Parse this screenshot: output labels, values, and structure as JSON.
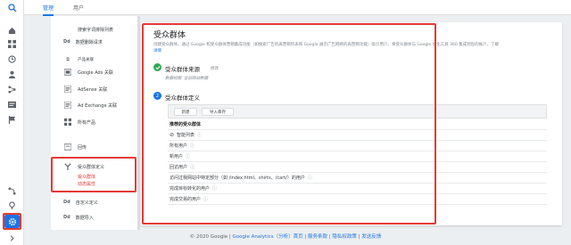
{
  "tabs": [
    {
      "label": "管理",
      "active": true
    },
    {
      "label": "用户",
      "active": false
    }
  ],
  "rail_icons": [
    "search-icon",
    "home-icon",
    "dashboard-icon",
    "clock-icon",
    "person-icon",
    "acquisition-icon",
    "behavior-icon",
    "flag-icon"
  ],
  "nav": {
    "items": [
      {
        "label": "搜索字词排除列表",
        "icon": ""
      },
      {
        "label": "数据删除请求",
        "icon": "Dd"
      },
      {
        "label": "产品关联",
        "icon": ""
      },
      {
        "label": "Google Ads 关联",
        "icon": "ads-icon"
      },
      {
        "label": "AdSense 关联",
        "icon": "adsense-icon"
      },
      {
        "label": "Ad Exchange 关联",
        "icon": "adx-icon"
      },
      {
        "label": "所有产品",
        "icon": "all-products-icon"
      },
      {
        "label": "回传",
        "icon": "postback-icon"
      },
      {
        "label": "受众群体定义",
        "icon": "audience-icon"
      },
      {
        "label": "受众群体",
        "icon": ""
      },
      {
        "label": "动态属性",
        "icon": ""
      },
      {
        "label": "自定义定义",
        "icon": "Dd"
      },
      {
        "label": "数据导入",
        "icon": "Dd"
      }
    ]
  },
  "panel": {
    "title": "受众群体",
    "description": "创建受众群体。通过 Google 和受众群体营销集成功能（如搜索广告的再营销列表和 Google 展示广告网络的再营销功能）吸引用户。将受众群体与 Google 优化工具 360 集成到您的帐户。了解",
    "learn_more": "详情",
    "step1": {
      "title": "受众群体来源",
      "action": "修改",
      "detail": "数据视图: 全部网站数据"
    },
    "step2": {
      "number": "2",
      "title": "受众群体定义"
    },
    "buttons": {
      "create": "新建",
      "import": "导入库存"
    },
    "list_header": "推荐的受众群体",
    "rows": [
      "智能列表",
      "所有用户",
      "新用户",
      "回访用户",
      "访问过我网站中特定部分（如 /index.html、shirts、/cart/）的用户",
      "完成目标转化的用户",
      "完成交易的用户"
    ]
  },
  "footer": {
    "copyright": "© 2020 Google |",
    "links": [
      "Google Analytics（分析）首页",
      "服务条款",
      "隐私权政策",
      "发送反馈"
    ],
    "separator": "|"
  },
  "colors": {
    "accent": "#1a73e8",
    "highlight": "#e53935",
    "check": "#34a853",
    "settings_bg": "#1a73e8"
  }
}
